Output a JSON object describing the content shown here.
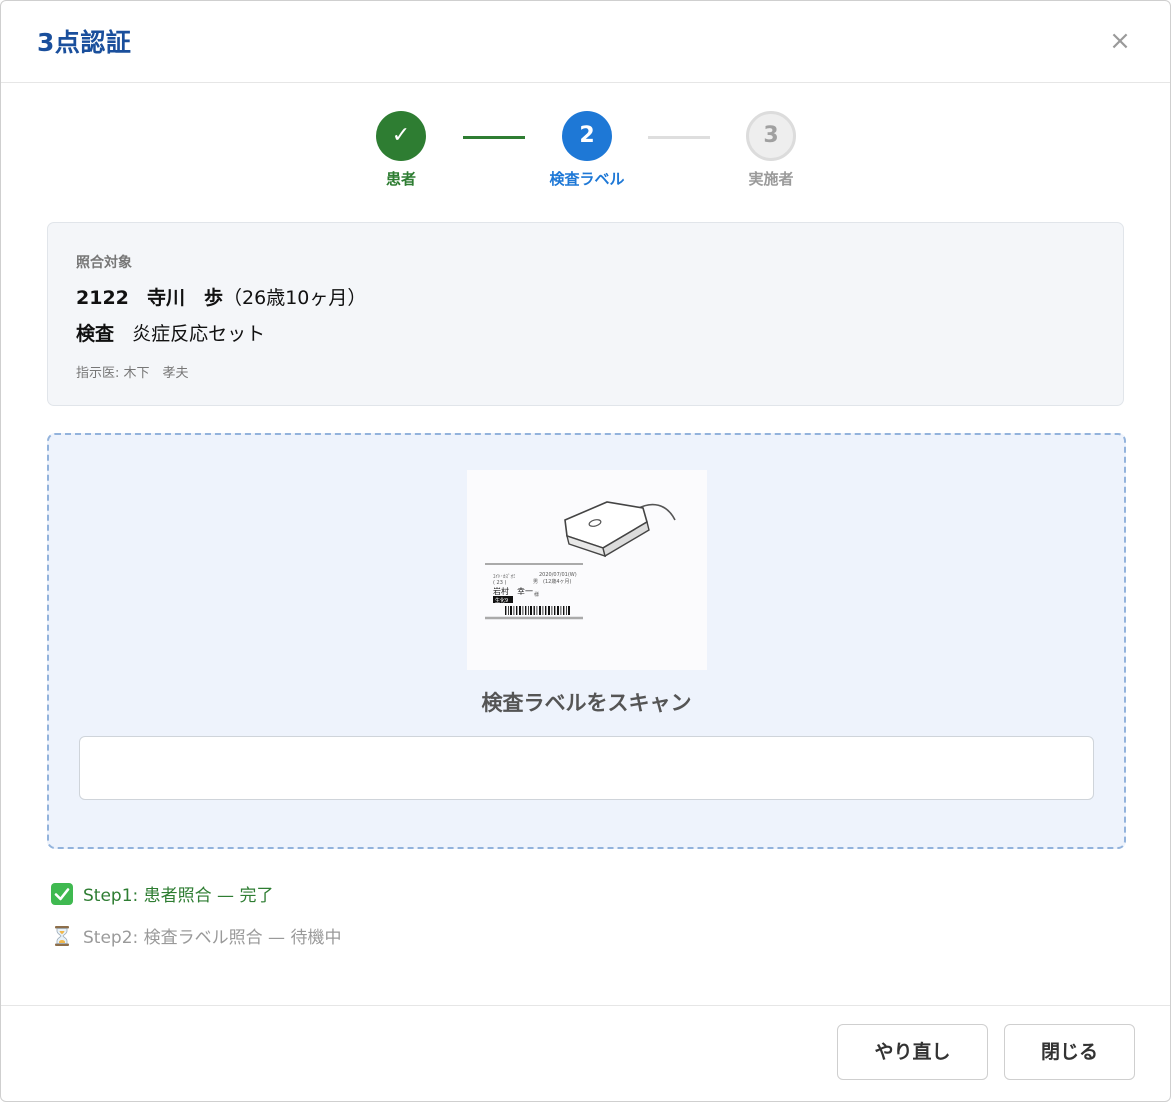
{
  "dialog": {
    "title": "3点認証",
    "close_label": "×"
  },
  "stepper": {
    "steps": [
      {
        "number": "✓",
        "label": "患者",
        "state": "done"
      },
      {
        "number": "2",
        "label": "検査ラベル",
        "state": "active"
      },
      {
        "number": "3",
        "label": "実施者",
        "state": "pending"
      }
    ]
  },
  "target": {
    "caption": "照合対象",
    "patient_id": "2122",
    "patient_name": "寺川　歩",
    "patient_age": "（26歳10ヶ月）",
    "exam_label": "検査",
    "exam_name": "炎症反応セット",
    "doctor": "指示医: 木下　孝夫"
  },
  "scan": {
    "illustration": {
      "label_line1_left": "ｴｲﾄ･ｶｽﾞｵﾐ",
      "label_line1_right": "2020/07/01(W)",
      "label_line2_left": "( 23 )",
      "label_line2_mid": "男",
      "label_line2_right": "(12歳4ヶ月)",
      "label_name": "岩村　幸一",
      "label_name_suffix": "様",
      "label_tag": "生化9"
    },
    "title": "検査ラベルをスキャン",
    "input_value": "",
    "input_placeholder": ""
  },
  "status": {
    "done_text": "Step1: 患者照合 — 完了",
    "wait_text": "Step2: 検査ラベル照合 — 待機中"
  },
  "footer": {
    "retry_label": "やり直し",
    "close_label": "閉じる"
  },
  "colors": {
    "title": "#1a4f9c",
    "done": "#2e7d32",
    "active": "#1e78d6",
    "pending": "#9a9a9a",
    "scan_bg": "#eef3fc",
    "scan_border": "#93b3dc"
  }
}
